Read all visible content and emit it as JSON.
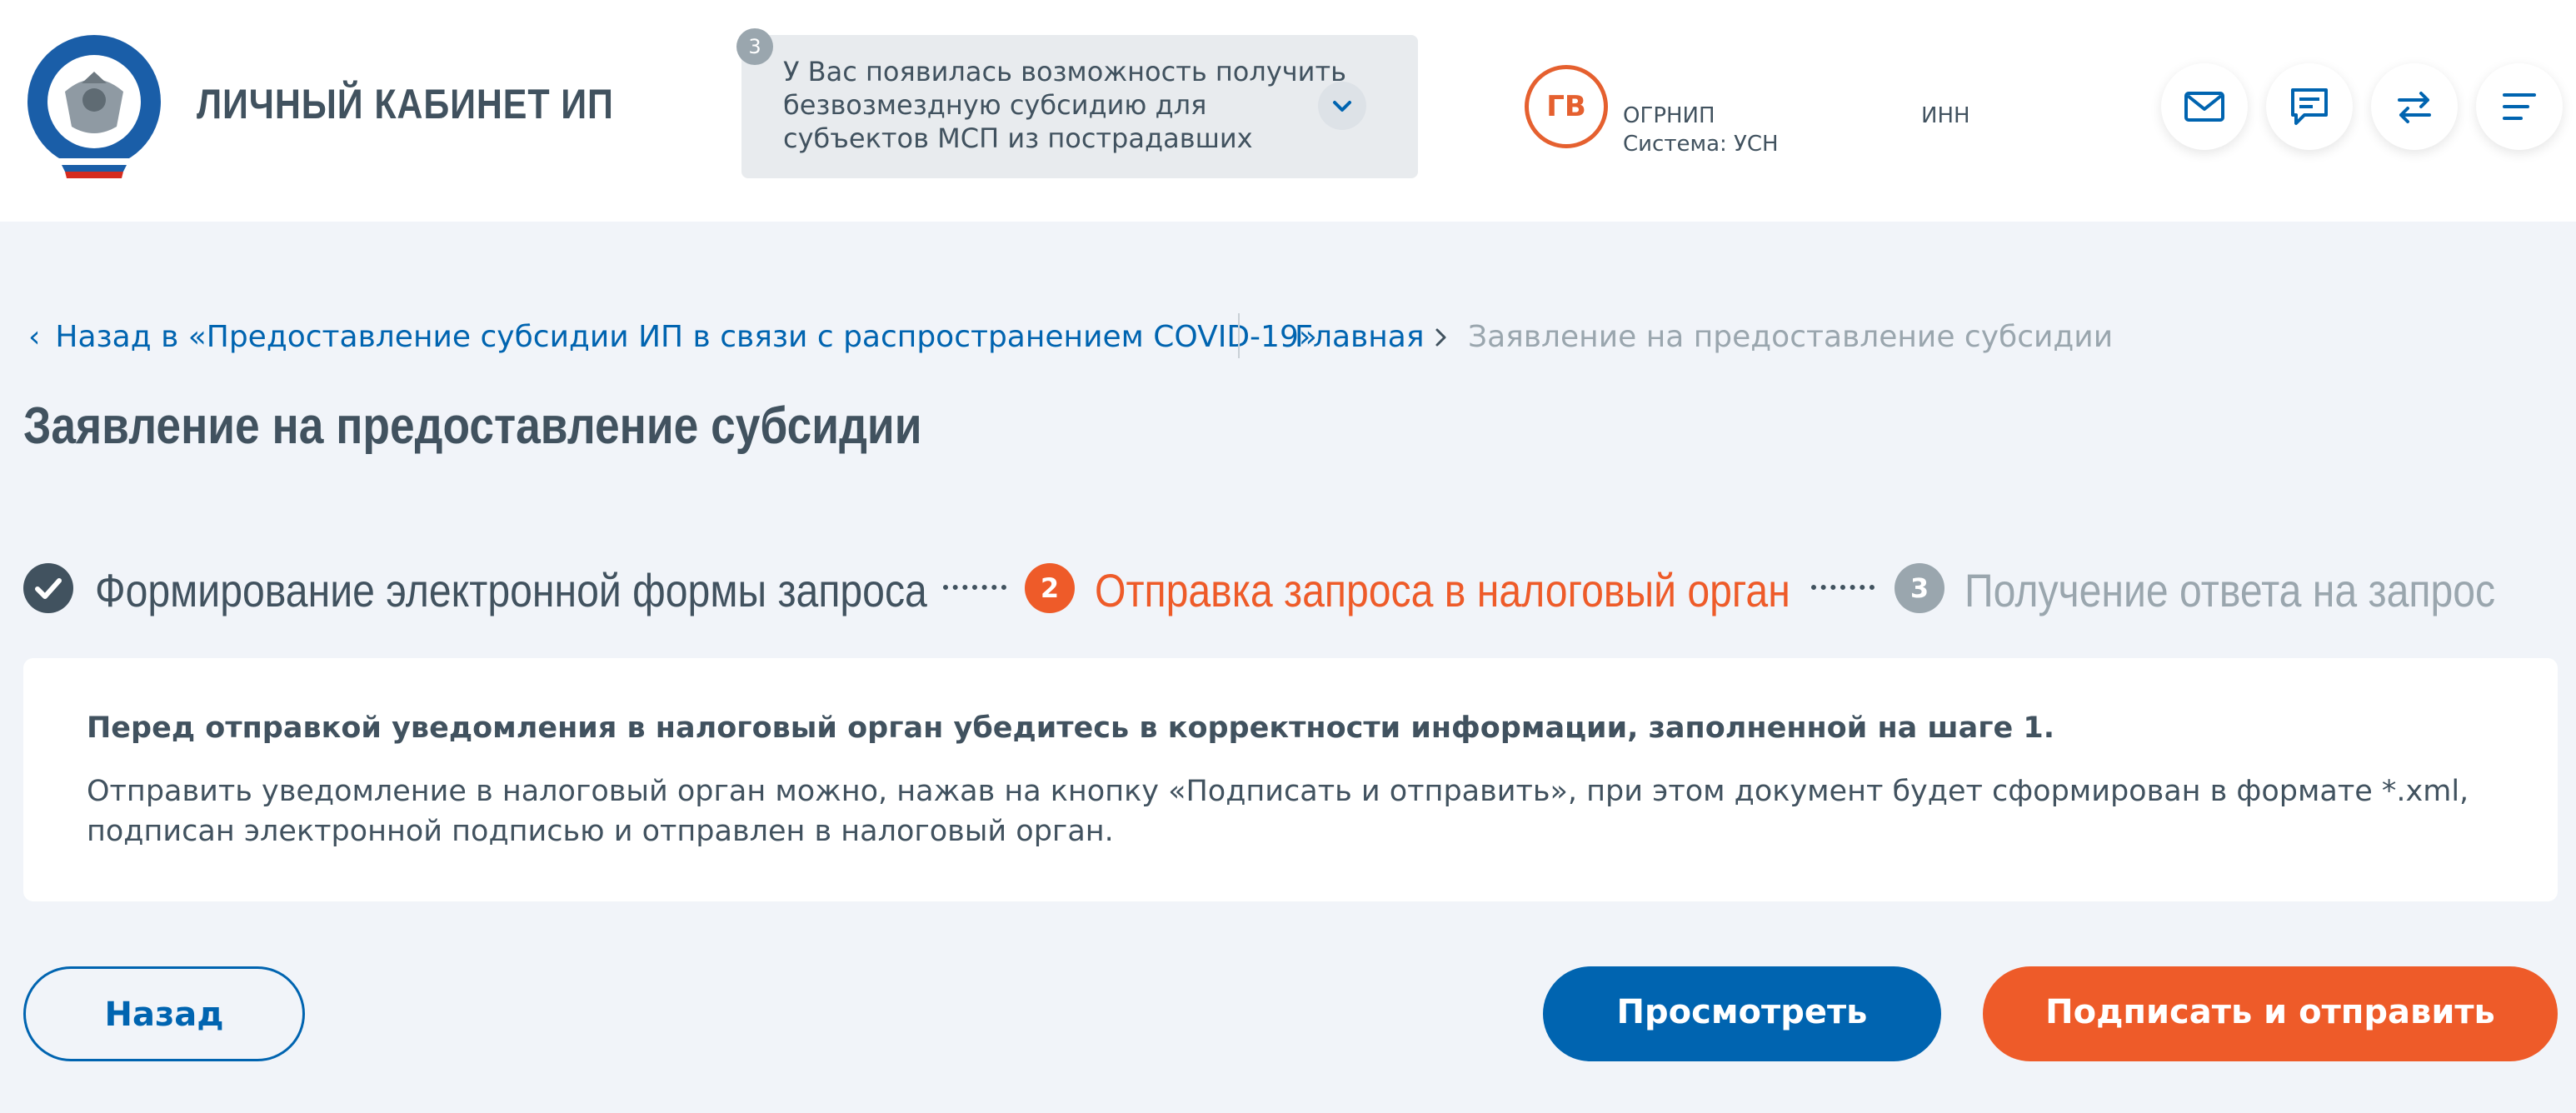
{
  "header": {
    "cabinet_title": "ЛИЧНЫЙ КАБИНЕТ ИП",
    "notice": {
      "count": "3",
      "text": "У Вас появилась возможность получить безвозмездную субсидию для субъектов МСП из пострадавших отраслей"
    },
    "user": {
      "initials": "ГВ",
      "ogrnip_label": "ОГРНИП",
      "system_label": "Система: УСН",
      "inn_label": "ИНН"
    },
    "icons": [
      "mail-icon",
      "chat-icon",
      "exchange-icon",
      "menu-icon"
    ]
  },
  "breadcrumbs": {
    "back_link": "Назад в «Предоставление субсидии ИП в связи с распространением COVID-19»",
    "home": "Главная",
    "current": "Заявление на предоставление субсидии"
  },
  "page": {
    "title": "Заявление на предоставление субсидии"
  },
  "steps": [
    {
      "label": "Формирование электронной формы запроса",
      "status": "done"
    },
    {
      "number": "2",
      "label": "Отправка запроса в налоговый орган",
      "status": "active"
    },
    {
      "number": "3",
      "label": "Получение ответа на запрос",
      "status": "pending"
    }
  ],
  "info": {
    "heading": "Перед отправкой уведомления в налоговый орган убедитесь в корректности информации, заполненной на шаге 1.",
    "text": "Отправить уведомление в налоговый орган можно, нажав на кнопку «Подписать и отправить», при этом документ будет сформирован в формате *.xml, подписан электронной подписью и отправлен в налоговый орган."
  },
  "buttons": {
    "back": "Назад",
    "view": "Просмотреть",
    "sign": "Подписать и отправить"
  },
  "colors": {
    "primary": "#0064b0",
    "accent": "#ee5b29",
    "text": "#41525f",
    "muted": "#9aa6ae",
    "background": "#f1f4f9"
  }
}
